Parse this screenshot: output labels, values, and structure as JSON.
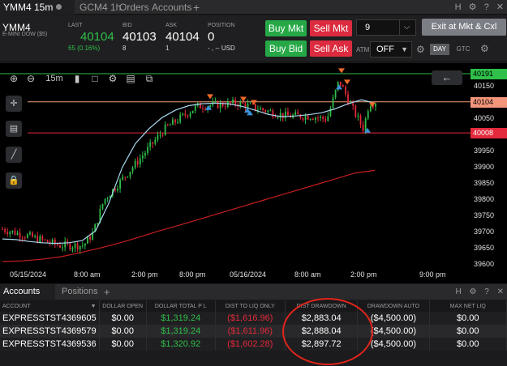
{
  "tabs": [
    {
      "label": "YMM4 15m",
      "active": true
    },
    {
      "label": "GCM4 1h",
      "active": false
    },
    {
      "label": "Orders",
      "active": false
    },
    {
      "label": "Accounts",
      "active": false
    }
  ],
  "tab_add": "+",
  "window_icons": [
    "H",
    "⚙",
    "?",
    "✕"
  ],
  "instrument": {
    "symbol": "YMM4",
    "description": "E-MINI DOW ($5)"
  },
  "quote": {
    "last_label": "LAST",
    "last": "40104",
    "last_change": "65 (0.16%)",
    "bid_label": "BID",
    "bid": "40103",
    "bid_size": "8",
    "ask_label": "ASK",
    "ask": "40104",
    "ask_size": "1",
    "position_label": "POSITION",
    "position": "0",
    "position_sub": "- , -- USD"
  },
  "order_buttons": {
    "buy_mkt": "Buy Mkt",
    "sell_mkt": "Sell Mkt",
    "buy_bid": "Buy Bid",
    "sell_ask": "Sell Ask"
  },
  "quantity": "9",
  "exit_button": "Exit at Mkt & Cxl",
  "atm_label": "ATM",
  "atm_value": "OFF",
  "tif": {
    "day": "DAY",
    "gtc": "GTC"
  },
  "chart_toolbar": {
    "interval": "15m"
  },
  "price_ticks": [
    "40191",
    "40150",
    "40100",
    "40050",
    "40000",
    "39950",
    "39900",
    "39850",
    "39800",
    "39750",
    "39700",
    "39650",
    "39600"
  ],
  "price_flags": {
    "top": "40191",
    "current": "40104",
    "bottom": "40008"
  },
  "time_ticks": [
    "05/15/2024",
    "8:00 am",
    "2:00 pm",
    "8:00 pm",
    "05/16/2024",
    "8:00 am",
    "2:00 pm",
    "9:00 pm"
  ],
  "colors": {
    "up": "#2fbf4a",
    "down": "#e3293b",
    "ma_fast": "#a8d8f0",
    "ma_slow": "#c41e1e",
    "line_top": "#2fbf4a",
    "line_mid": "#f0a07a",
    "line_bottom": "#e3293b"
  },
  "chart_data": {
    "type": "candlestick",
    "y_range": [
      39590,
      40210
    ],
    "ma_slow_values": [
      39610,
      39612,
      39617,
      39625,
      39638,
      39652,
      39668,
      39686,
      39705,
      39722,
      39740,
      39758,
      39776,
      39794,
      39812,
      39830,
      39848,
      39866,
      39884,
      39892
    ],
    "ma_fast_values": [
      39680,
      39678,
      39672,
      39668,
      39666,
      39668,
      39675,
      39705,
      39790,
      39900,
      39975,
      40020,
      40055,
      40078,
      40092,
      40098,
      40100,
      40098,
      40090,
      40078,
      40065,
      40058,
      40060,
      40064,
      40070,
      40082,
      40098,
      40110,
      40100
    ]
  },
  "accounts_panel": {
    "tabs": [
      "Accounts",
      "Positions"
    ],
    "add": "+",
    "icons": [
      "H",
      "⚙",
      "?",
      "✕"
    ],
    "columns": [
      "ACCOUNT",
      "DOLLAR OPEN",
      "DOLLAR TOTAL P L",
      "DIST TO LIQ ONLY",
      "DIST DRAWDOWN",
      "DRAWDOWN AUTO",
      "MAX NET LIQ"
    ],
    "rows": [
      [
        "EXPRESSTST4369605",
        "$0.00",
        "$1,319.24",
        "($1,616.96)",
        "$2,883.04",
        "($4,500.00)",
        "$0.00"
      ],
      [
        "EXPRESSTST4369579",
        "$0.00",
        "$1,319.24",
        "($1,611.96)",
        "$2,888.04",
        "($4,500.00)",
        "$0.00"
      ],
      [
        "EXPRESSTST4369536",
        "$0.00",
        "$1,320.92",
        "($1,602.28)",
        "$2,897.72",
        "($4,500.00)",
        "$0.00"
      ]
    ]
  }
}
